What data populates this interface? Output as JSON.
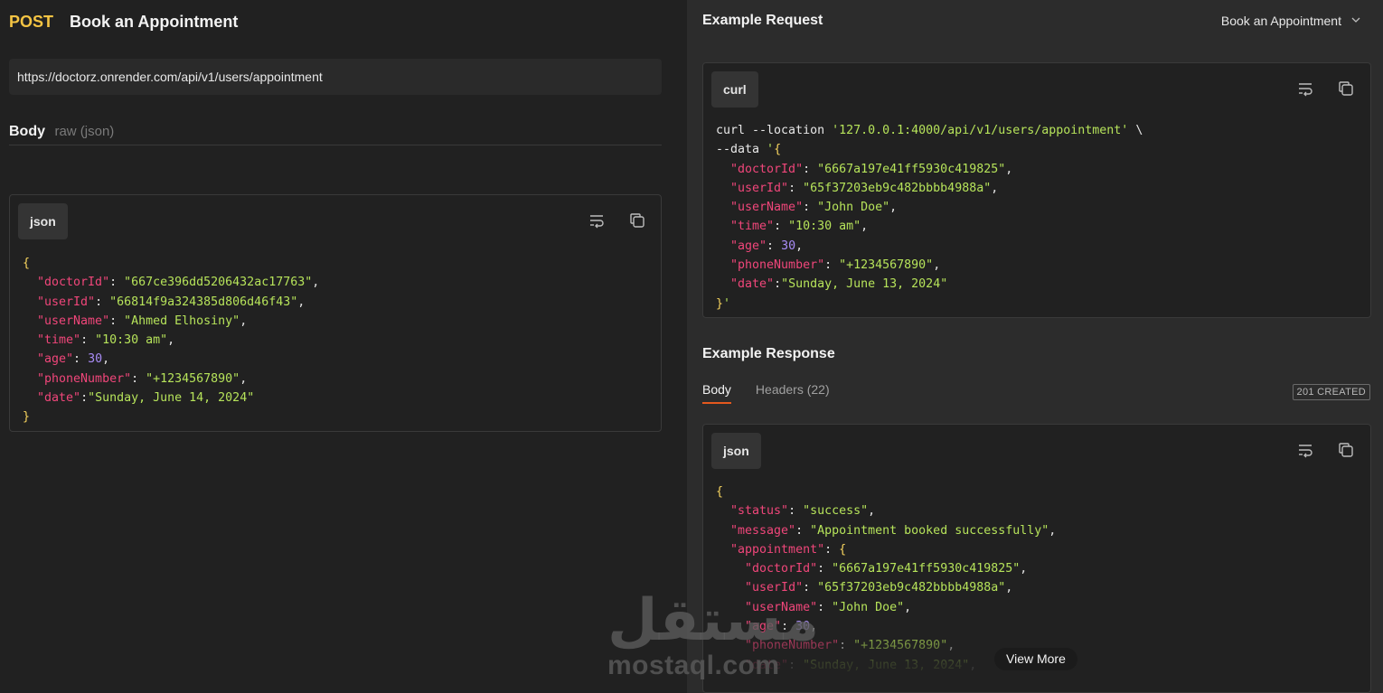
{
  "request": {
    "method": "POST",
    "title": "Book an Appointment",
    "url": "https://doctorz.onrender.com/api/v1/users/appointment",
    "body_label": "Body",
    "body_sub": "raw (json)",
    "lang": "json"
  },
  "example_request": {
    "title": "Example Request",
    "selected": "Book an Appointment",
    "lang": "curl"
  },
  "example_response": {
    "title": "Example Response",
    "tabs": [
      "Body",
      "Headers (22)"
    ],
    "status": "201 CREATED",
    "lang": "json",
    "view_more": "View More"
  },
  "watermark": {
    "arabic": "مستقل",
    "latin": "mostaql.com"
  },
  "colors": {
    "method": "#f4c443",
    "key": "#f0467a",
    "string": "#b6e35a",
    "number": "#a98cf6",
    "accent": "#e4581e"
  },
  "icons": [
    "wrap-icon",
    "copy-icon",
    "chevron-down-icon"
  ]
}
